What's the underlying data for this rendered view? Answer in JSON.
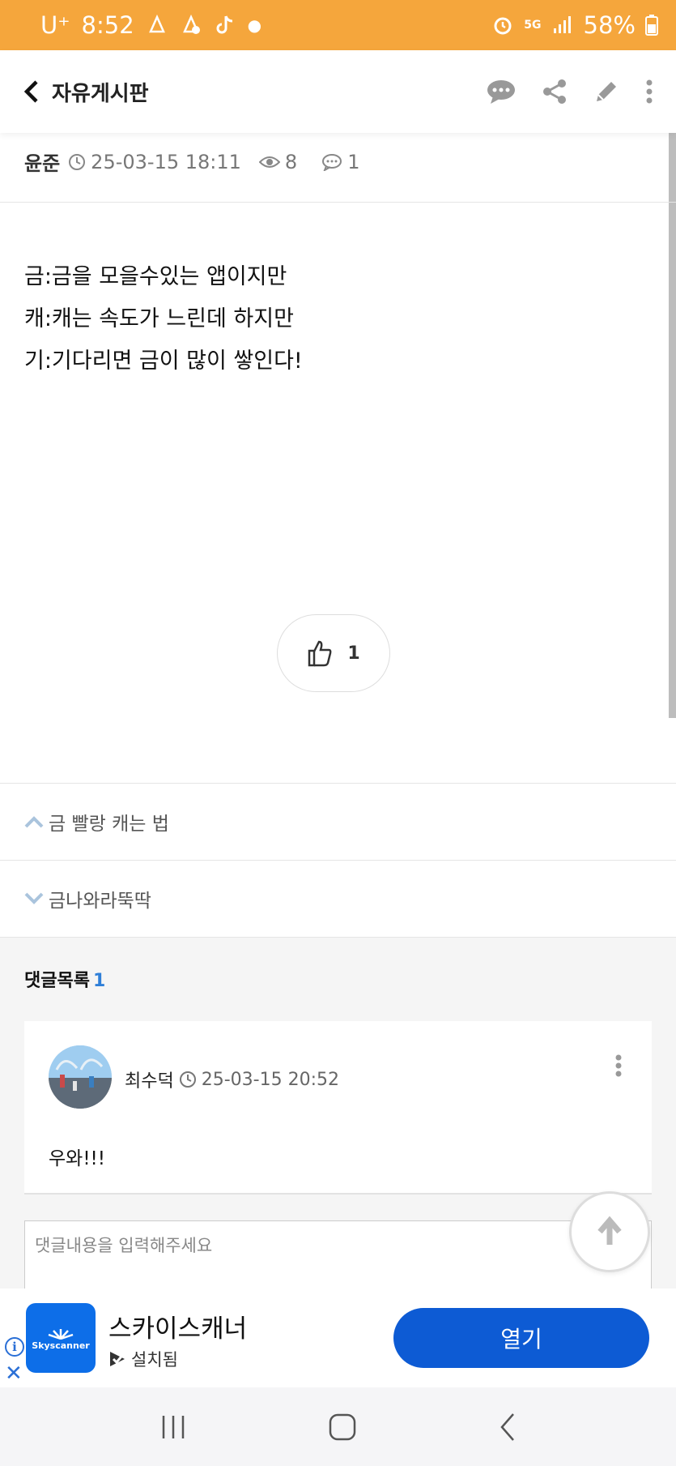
{
  "status_bar": {
    "carrier": "U⁺",
    "time": "8:52",
    "network": "5G",
    "battery": "58%"
  },
  "header": {
    "back_icon": "chevron-left-icon",
    "title": "자유게시판",
    "actions": [
      "chat-icon",
      "share-icon",
      "edit-icon",
      "more-vertical-icon"
    ]
  },
  "post": {
    "author": "윤준",
    "date": "25-03-15 18:11",
    "views": "8",
    "comments": "1",
    "lines": [
      "금:금을 모을수있는 앱이지만",
      "캐:캐는 속도가 느린데 하지만",
      "기:기다리면 금이 많이 쌓인다!"
    ],
    "likes": "1"
  },
  "navigation": {
    "prev": "금 빨랑 캐는 법",
    "next": "금나와라뚝딱"
  },
  "comments": {
    "title": "댓글목록",
    "count": "1",
    "items": [
      {
        "author": "최수덕",
        "date": "25-03-15 20:52",
        "text": "우와!!!"
      }
    ],
    "input_placeholder": "댓글내용을 입력해주세요"
  },
  "ad": {
    "app_name": "스카이스캐너",
    "status": "설치됨",
    "logo_text": "Skyscanner",
    "button": "열기"
  },
  "colors": {
    "status_bar": "#f5a63c",
    "accent_blue": "#2f7fd8",
    "ad_button": "#0d5bd4"
  }
}
